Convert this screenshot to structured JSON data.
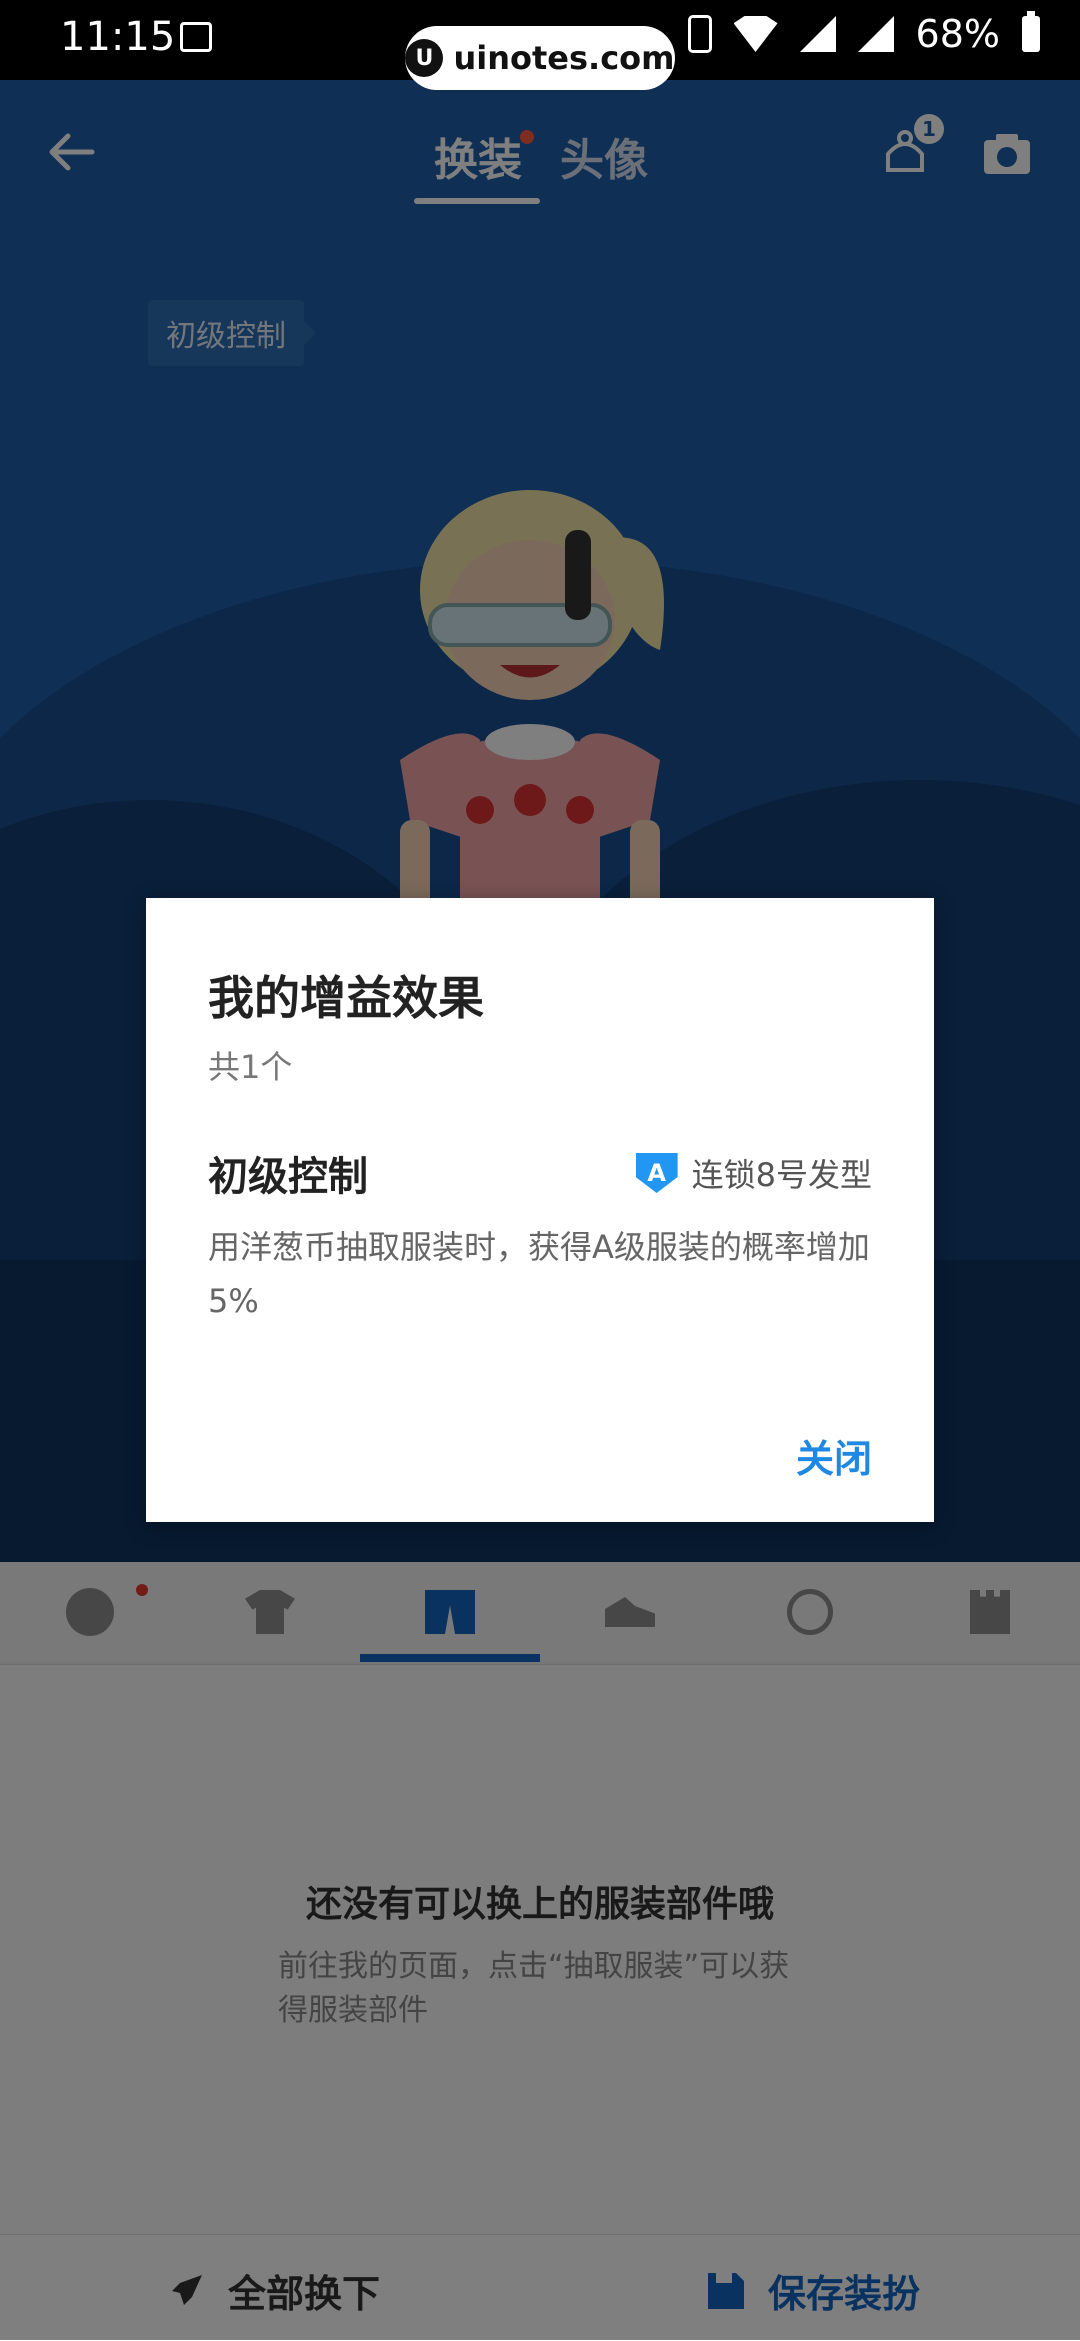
{
  "status_bar": {
    "time": "11:15",
    "battery": "68%"
  },
  "watermark": {
    "text": "uinotes.com"
  },
  "nav": {
    "tabs": [
      {
        "label": "换装"
      },
      {
        "label": "头像"
      }
    ],
    "wardrobe_badge": "1"
  },
  "stage": {
    "effect_tag": "初级控制"
  },
  "categories": [
    "face",
    "top",
    "bottom",
    "shoes",
    "accessory",
    "background"
  ],
  "empty_state": {
    "title": "还没有可以换上的服装部件哦",
    "subtitle": "前往我的页面，点击“抽取服装”可以获得服装部件"
  },
  "actions": {
    "remove_all": "全部换下",
    "save_outfit": "保存装扮"
  },
  "dialog": {
    "title": "我的增益效果",
    "count": "共1个",
    "effect_name": "初级控制",
    "grade_badge": "A",
    "source": "连锁8号发型",
    "description": "用洋葱币抽取服装时，获得A级服装的概率增加5%",
    "close_label": "关闭"
  },
  "colors": {
    "accent": "#1e88e5",
    "stage_bg": "#1f5ea8",
    "active_tab": "#1565c0"
  }
}
